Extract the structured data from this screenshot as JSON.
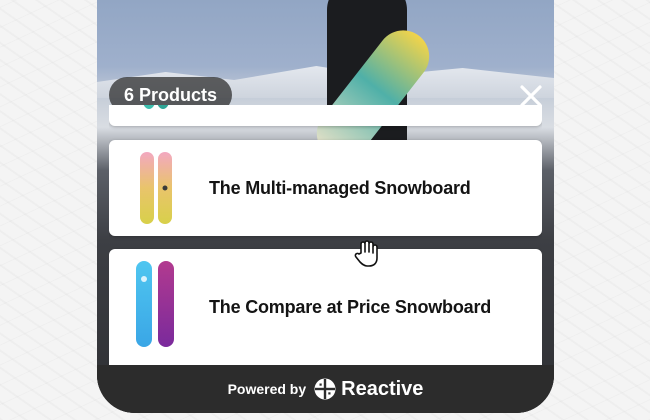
{
  "header": {
    "product_count": "6 Products"
  },
  "products": [
    {
      "title": "",
      "thumb_icon": "snowboard-teal-thumb"
    },
    {
      "title": "The Multi-managed Snowboard",
      "thumb_icon": "snowboard-pink-yellow-thumb"
    },
    {
      "title": "The Compare at Price Snowboard",
      "thumb_icon": "snowboard-blue-purple-thumb"
    }
  ],
  "footer": {
    "powered_by": "Powered by",
    "brand": "Reactive"
  },
  "colors": {
    "panel_dark": "#2c2c2c",
    "card_bg": "#ffffff",
    "text_dark": "#141414"
  }
}
